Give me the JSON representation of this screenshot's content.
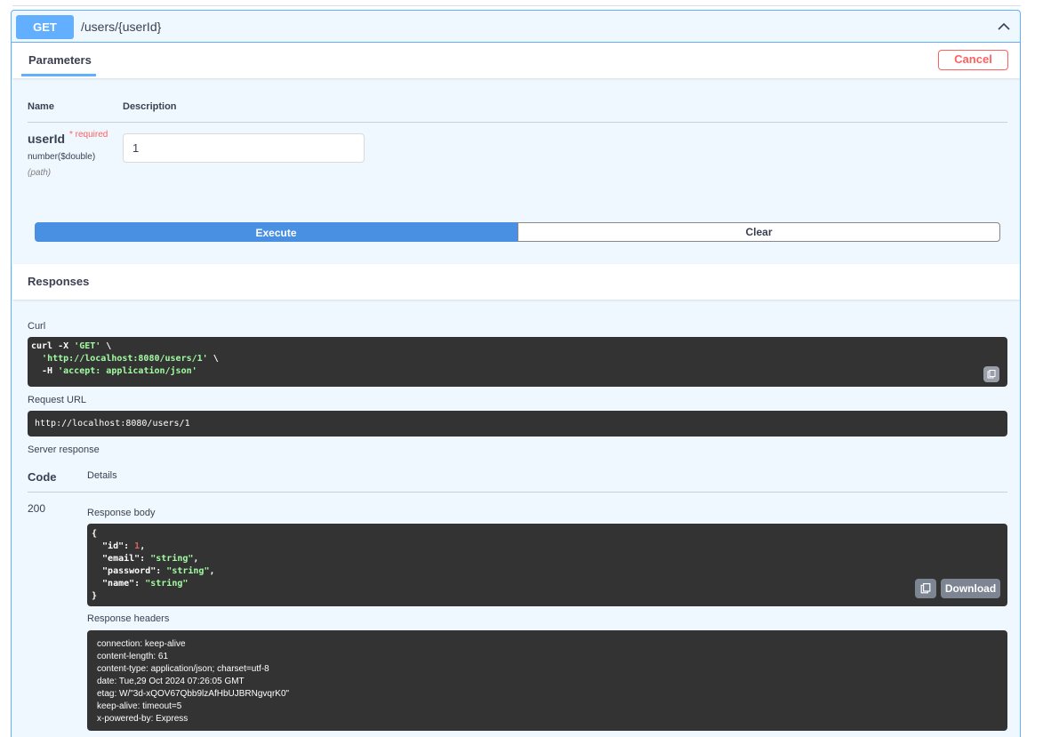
{
  "operation": {
    "method": "GET",
    "path": "/users/{userId}"
  },
  "parameters": {
    "tab_label": "Parameters",
    "cancel_label": "Cancel",
    "col_name": "Name",
    "col_description": "Description",
    "items": [
      {
        "name": "userId",
        "required_label": "* required",
        "type": "number($double)",
        "in": "(path)",
        "value": "1"
      }
    ]
  },
  "actions": {
    "execute_label": "Execute",
    "clear_label": "Clear"
  },
  "responses": {
    "title": "Responses",
    "curl_label": "Curl",
    "curl_lines": [
      {
        "prefix": "curl -X ",
        "str": "'GET'",
        "suffix": " \\"
      },
      {
        "prefix": "  ",
        "str": "'http://localhost:8080/users/1'",
        "suffix": " \\"
      },
      {
        "prefix": "  -H ",
        "str": "'accept: application/json'",
        "suffix": ""
      }
    ],
    "request_url_label": "Request URL",
    "request_url": "http://localhost:8080/users/1",
    "server_response_label": "Server response",
    "col_code": "Code",
    "col_details": "Details",
    "code": "200",
    "response_body_label": "Response body",
    "response_body": {
      "open": "{",
      "fields": [
        {
          "key": "\"id\"",
          "value": "1",
          "type": "number",
          "comma": ","
        },
        {
          "key": "\"email\"",
          "value": "\"string\"",
          "type": "string",
          "comma": ","
        },
        {
          "key": "\"password\"",
          "value": "\"string\"",
          "type": "string",
          "comma": ","
        },
        {
          "key": "\"name\"",
          "value": "\"string\"",
          "type": "string",
          "comma": ""
        }
      ],
      "close": "}"
    },
    "download_label": "Download",
    "response_headers_label": "Response headers",
    "response_headers": [
      "connection: keep-alive",
      "content-length: 61",
      "content-type: application/json; charset=utf-8",
      "date: Tue,29 Oct 2024 07:26:05 GMT",
      "etag: W/\"3d-xQOV67Qbb9lzAfHbUJBRNgvqrK0\"",
      "keep-alive: timeout=5",
      "x-powered-by: Express"
    ]
  },
  "colors": {
    "get_blue": "#61affe",
    "execute_blue": "#4990e2",
    "cancel_red": "#ff6060",
    "code_bg": "#333333",
    "string_green": "#a2fca2",
    "number_red": "#d36363"
  }
}
